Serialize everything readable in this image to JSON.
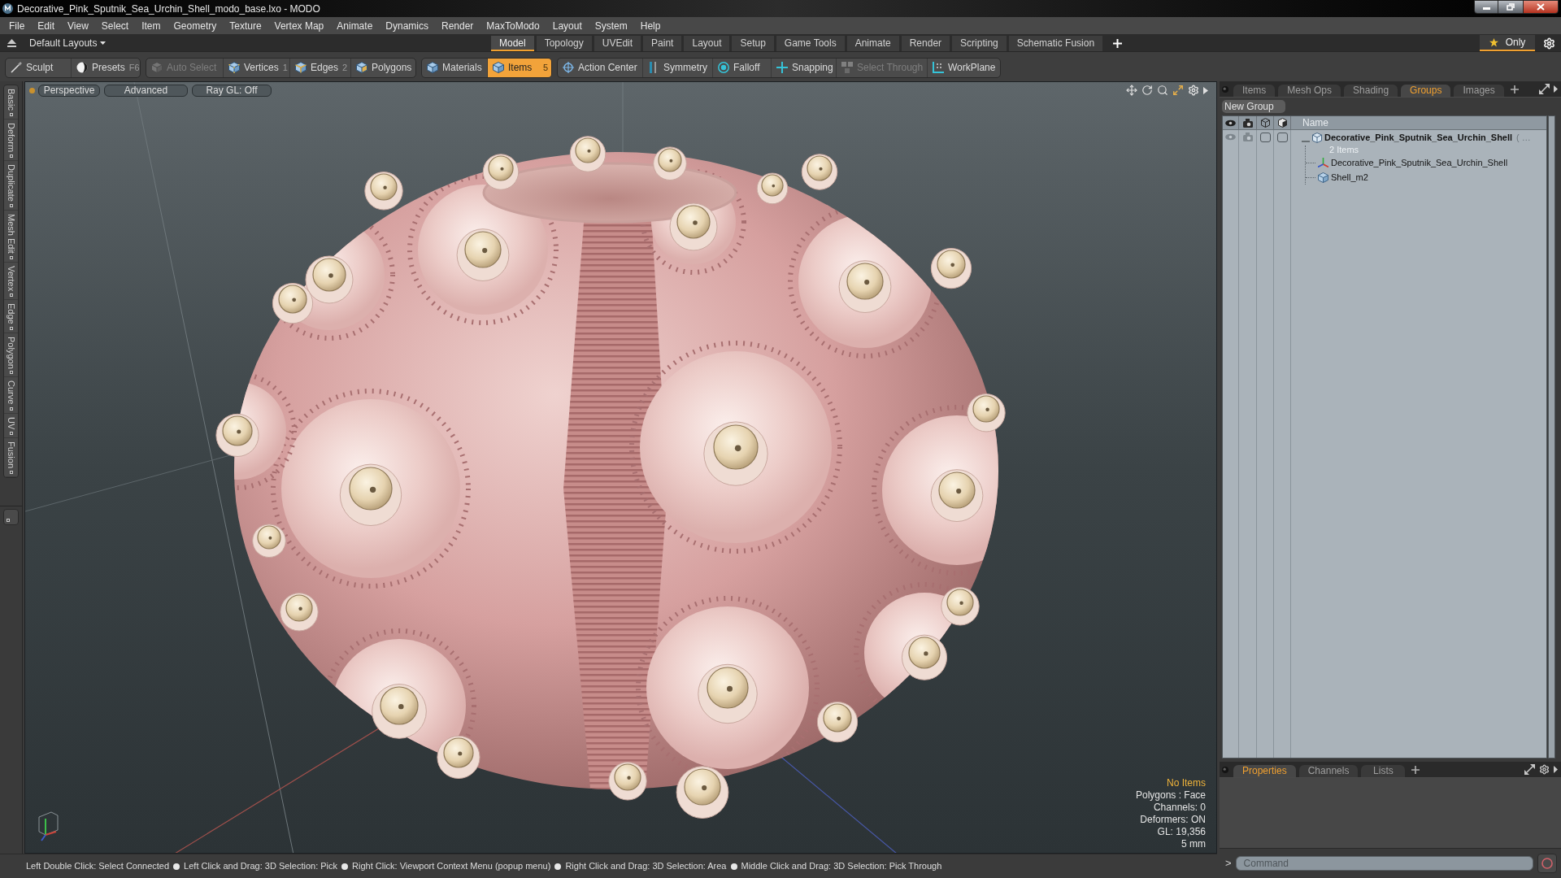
{
  "window": {
    "title": "Decorative_Pink_Sputnik_Sea_Urchin_Shell_modo_base.lxo - MODO"
  },
  "menu": [
    "File",
    "Edit",
    "View",
    "Select",
    "Item",
    "Geometry",
    "Texture",
    "Vertex Map",
    "Animate",
    "Dynamics",
    "Render",
    "MaxToModo",
    "Layout",
    "System",
    "Help"
  ],
  "layout_bar": {
    "layout_menu": "Default Layouts",
    "tabs": [
      {
        "label": "Model",
        "selected": true
      },
      {
        "label": "Topology",
        "selected": false
      },
      {
        "label": "UVEdit",
        "selected": false
      },
      {
        "label": "Paint",
        "selected": false
      },
      {
        "label": "Layout",
        "selected": false
      },
      {
        "label": "Setup",
        "selected": false
      },
      {
        "label": "Game Tools",
        "selected": false
      },
      {
        "label": "Animate",
        "selected": false
      },
      {
        "label": "Render",
        "selected": false
      },
      {
        "label": "Scripting",
        "selected": false
      },
      {
        "label": "Schematic Fusion",
        "selected": false
      }
    ],
    "only_toggle": {
      "label": "Only",
      "on": true
    }
  },
  "toolbar": [
    {
      "items": [
        {
          "label": "Sculpt",
          "selected": false,
          "disabled": false
        },
        {
          "label": "Presets",
          "shortcut": "F6",
          "selected": false,
          "disabled": false
        }
      ]
    },
    {
      "items": [
        {
          "label": "Auto Select",
          "selected": false,
          "disabled": true
        },
        {
          "label": "Vertices",
          "shortcut": "1",
          "selected": false,
          "disabled": false
        },
        {
          "label": "Edges",
          "shortcut": "2",
          "selected": false,
          "disabled": false
        },
        {
          "label": "Polygons",
          "selected": false,
          "disabled": false
        }
      ]
    },
    {
      "items": [
        {
          "label": "Materials",
          "selected": false,
          "disabled": false
        },
        {
          "label": "Items",
          "shortcut": "5",
          "selected": true,
          "disabled": false
        }
      ]
    },
    {
      "items": [
        {
          "label": "Action Center",
          "selected": false,
          "disabled": false
        },
        {
          "label": "Symmetry",
          "selected": false,
          "disabled": false
        },
        {
          "label": "Falloff",
          "selected": false,
          "disabled": false
        },
        {
          "label": "Snapping",
          "selected": false,
          "disabled": false
        },
        {
          "label": "Select Through",
          "selected": false,
          "disabled": true
        },
        {
          "label": "WorkPlane",
          "selected": false,
          "disabled": false
        }
      ]
    }
  ],
  "side_tabs": [
    "Basic",
    "Deform",
    "Duplicate",
    "Mesh Edit",
    "Vertex",
    "Edge",
    "Polygon",
    "Curve",
    "UV",
    "Fusion"
  ],
  "viewport": {
    "buttons": [
      "Perspective",
      "Advanced",
      "Ray GL: Off"
    ],
    "info": [
      {
        "text": "No Items",
        "kind": "status"
      },
      {
        "text": "Polygons : Face",
        "kind": "stat"
      },
      {
        "text": "Channels: 0",
        "kind": "stat"
      },
      {
        "text": "Deformers: ON",
        "kind": "stat"
      },
      {
        "text": "GL: 19,356",
        "kind": "stat"
      },
      {
        "text": "5 mm",
        "kind": "stat"
      }
    ]
  },
  "status_bar": {
    "hints": [
      "Left Double Click: Select Connected",
      "Left Click and Drag: 3D Selection: Pick",
      "Right Click: Viewport Context Menu (popup menu)",
      "Right Click and Drag: 3D Selection: Area",
      "Middle Click and Drag: 3D Selection: Pick Through"
    ]
  },
  "item_panel": {
    "tabs": [
      {
        "label": "Items",
        "selected": false
      },
      {
        "label": "Mesh Ops",
        "selected": false
      },
      {
        "label": "Shading",
        "selected": false
      },
      {
        "label": "Groups",
        "selected": true
      },
      {
        "label": "Images",
        "selected": false
      }
    ],
    "new_group": "New Group",
    "name_column": "Name",
    "groups": [
      {
        "name": "Decorative_Pink_Sputnik_Sea_Urchin_Shell",
        "suffix": "( …",
        "count": "2 Items",
        "expanded": true,
        "children": [
          {
            "name": "Decorative_Pink_Sputnik_Sea_Urchin_Shell",
            "kind": "locator"
          },
          {
            "name": "Shell_m2",
            "kind": "mesh"
          }
        ]
      }
    ]
  },
  "properties_panel": {
    "tabs": [
      {
        "label": "Properties",
        "selected": true
      },
      {
        "label": "Channels",
        "selected": false
      },
      {
        "label": "Lists",
        "selected": false
      }
    ],
    "command": {
      "prompt": ">",
      "placeholder": "Command"
    }
  }
}
